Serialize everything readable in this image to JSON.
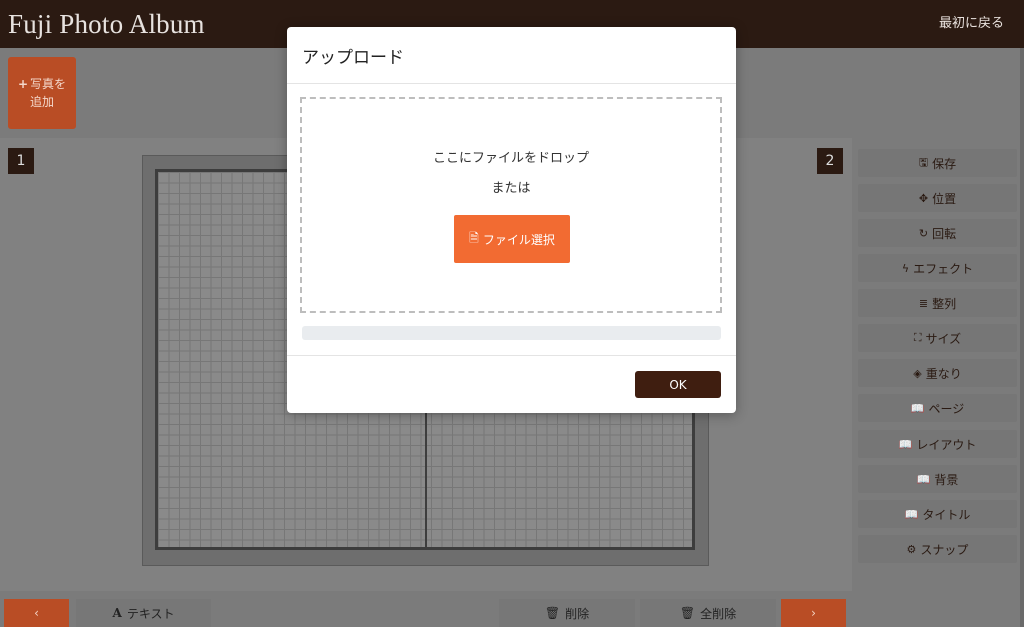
{
  "app": {
    "title": "Fuji Photo Album",
    "back_label": "最初に戻る"
  },
  "toolbar": {
    "add_photo_line1": "写真を",
    "add_photo_line2": "追加"
  },
  "pages": {
    "left": "1",
    "right": "2"
  },
  "side_menu": [
    {
      "label": "保存",
      "icon": "save-icon"
    },
    {
      "label": "位置",
      "icon": "move-icon"
    },
    {
      "label": "回転",
      "icon": "rotate-icon"
    },
    {
      "label": "エフェクト",
      "icon": "bolt-icon"
    },
    {
      "label": "整列",
      "icon": "align-icon"
    },
    {
      "label": "サイズ",
      "icon": "resize-icon"
    },
    {
      "label": "重なり",
      "icon": "layers-icon"
    },
    {
      "label": "ページ",
      "icon": "book-icon"
    },
    {
      "label": "レイアウト",
      "icon": "book-icon"
    },
    {
      "label": "背景",
      "icon": "book-icon"
    },
    {
      "label": "タイトル",
      "icon": "book-icon"
    },
    {
      "label": "スナップ",
      "icon": "gear-icon"
    }
  ],
  "bottom_bar": {
    "text_label": "テキスト",
    "delete_label": "削除",
    "delete_all_label": "全削除"
  },
  "modal": {
    "title": "アップロード",
    "drop_text": "ここにファイルをドロップ",
    "or_text": "または",
    "select_label": "ファイル選択",
    "ok_label": "OK",
    "progress": 0
  },
  "colors": {
    "header": "#2b1a12",
    "accent": "#f26b32",
    "ok": "#3f1e10"
  }
}
